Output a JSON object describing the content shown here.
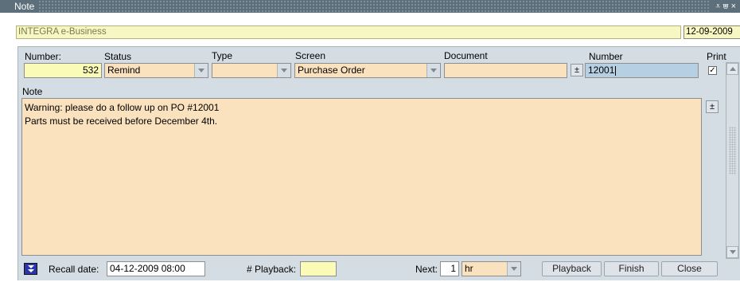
{
  "window": {
    "title": "Note",
    "controls": "⩡⩐×"
  },
  "header": {
    "company": "INTEGRA e-Business",
    "date": "12-09-2009"
  },
  "form": {
    "number_label": "Number:",
    "number_value": "532",
    "status_label": "Status",
    "status_value": "Remind",
    "type_label": "Type",
    "type_value": "",
    "screen_label": "Screen",
    "screen_value": "Purchase Order",
    "document_label": "Document",
    "document_value": "",
    "docnumber_label": "Number",
    "docnumber_value": "12001",
    "print_label": "Print",
    "print_checked": "✓",
    "note_label": "Note",
    "note_lines": [
      "Warning: please do a follow up on PO #12001",
      "Parts must be received before December 4th."
    ]
  },
  "footer": {
    "recall_label": "Recall date:",
    "recall_value": "04-12-2009 08:00",
    "playback_label": "# Playback:",
    "playback_value": "",
    "next_label": "Next:",
    "next_value": "1",
    "next_unit": "hr",
    "playback_button": "Playback",
    "finish_button": "Finish",
    "close_button": "Close"
  },
  "icons": {
    "expand_glyph": "±"
  },
  "colors": {
    "yellow_field": "#fbfbb8",
    "peach_field": "#fbe2be",
    "blue_field": "#b7cfe2",
    "panel": "#d4dde3"
  }
}
